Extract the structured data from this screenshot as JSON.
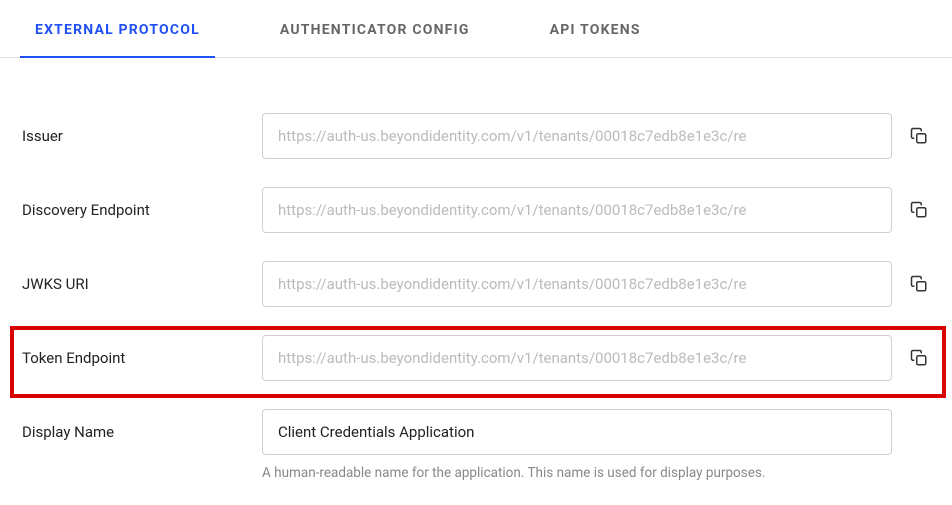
{
  "tabs": [
    {
      "label": "EXTERNAL PROTOCOL",
      "active": true
    },
    {
      "label": "AUTHENTICATOR CONFIG",
      "active": false
    },
    {
      "label": "API TOKENS",
      "active": false
    }
  ],
  "fields": {
    "issuer": {
      "label": "Issuer",
      "value": "https://auth-us.beyondidentity.com/v1/tenants/00018c7edb8e1e3c/re"
    },
    "discovery": {
      "label": "Discovery Endpoint",
      "value": "https://auth-us.beyondidentity.com/v1/tenants/00018c7edb8e1e3c/re"
    },
    "jwks": {
      "label": "JWKS URI",
      "value": "https://auth-us.beyondidentity.com/v1/tenants/00018c7edb8e1e3c/re"
    },
    "token": {
      "label": "Token Endpoint",
      "value": "https://auth-us.beyondidentity.com/v1/tenants/00018c7edb8e1e3c/re"
    },
    "display_name": {
      "label": "Display Name",
      "value": "Client Credentials Application",
      "help": "A human-readable name for the application. This name is used for display purposes."
    }
  }
}
